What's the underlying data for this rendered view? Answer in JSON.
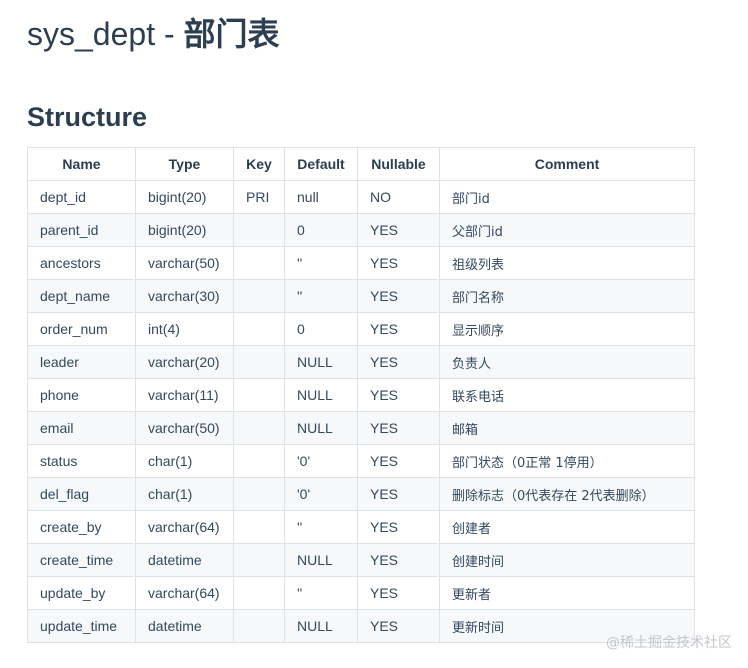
{
  "title": {
    "en": "sys_dept - ",
    "cn": "部门表"
  },
  "section_title": "Structure",
  "table": {
    "headers": [
      "Name",
      "Type",
      "Key",
      "Default",
      "Nullable",
      "Comment"
    ],
    "rows": [
      [
        "dept_id",
        "bigint(20)",
        "PRI",
        "null",
        "NO",
        "部门id"
      ],
      [
        "parent_id",
        "bigint(20)",
        "",
        "0",
        "YES",
        "父部门id"
      ],
      [
        "ancestors",
        "varchar(50)",
        "",
        "''",
        "YES",
        "祖级列表"
      ],
      [
        "dept_name",
        "varchar(30)",
        "",
        "''",
        "YES",
        "部门名称"
      ],
      [
        "order_num",
        "int(4)",
        "",
        "0",
        "YES",
        "显示顺序"
      ],
      [
        "leader",
        "varchar(20)",
        "",
        "NULL",
        "YES",
        "负责人"
      ],
      [
        "phone",
        "varchar(11)",
        "",
        "NULL",
        "YES",
        "联系电话"
      ],
      [
        "email",
        "varchar(50)",
        "",
        "NULL",
        "YES",
        "邮箱"
      ],
      [
        "status",
        "char(1)",
        "",
        "'0'",
        "YES",
        "部门状态（0正常 1停用）"
      ],
      [
        "del_flag",
        "char(1)",
        "",
        "'0'",
        "YES",
        "删除标志（0代表存在 2代表删除）"
      ],
      [
        "create_by",
        "varchar(64)",
        "",
        "''",
        "YES",
        "创建者"
      ],
      [
        "create_time",
        "datetime",
        "",
        "NULL",
        "YES",
        "创建时间"
      ],
      [
        "update_by",
        "varchar(64)",
        "",
        "''",
        "YES",
        "更新者"
      ],
      [
        "update_time",
        "datetime",
        "",
        "NULL",
        "YES",
        "更新时间"
      ]
    ]
  },
  "watermark": "@稀土掘金技术社区"
}
